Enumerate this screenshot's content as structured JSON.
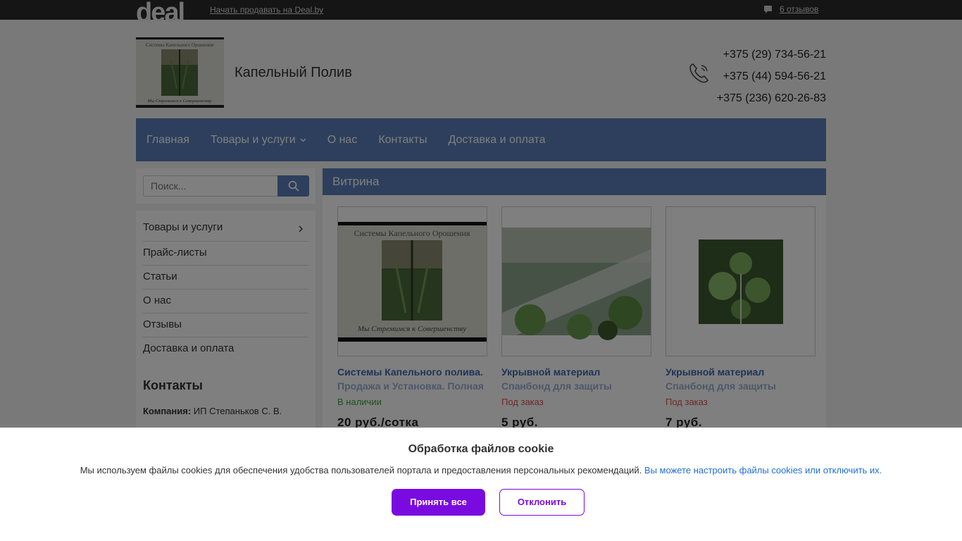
{
  "topbar": {
    "logo": "deal",
    "sell_link": "Начать продавать на Deal.by",
    "reviews": "6 отзывов",
    "reviews_icon": "comment-icon"
  },
  "header": {
    "company_name": "Капельный Полив",
    "logo_caption_top": "Системы Капельного Орошения",
    "logo_caption_bottom": "Мы Стремимся к Совершенству",
    "phones": [
      "+375 (29) 734-56-21",
      "+375 (44) 594-56-21",
      "+375 (236) 620-26-83"
    ],
    "phone_icon": "phone-icon"
  },
  "nav": {
    "items": [
      "Главная",
      "Товары и услуги",
      "О нас",
      "Контакты",
      "Доставка и оплата"
    ],
    "accent": "#5b7eb9"
  },
  "search": {
    "placeholder": "Поиск...",
    "icon": "search-icon"
  },
  "sidebar": {
    "items": [
      "Товары и услуги",
      "Прайс-листы",
      "Статьи",
      "О нас",
      "Отзывы",
      "Доставка и оплата"
    ],
    "contacts_title": "Контакты",
    "company_label": "Компания:",
    "company_value": "ИП Степаньков С. В."
  },
  "main": {
    "title": "Витрина",
    "products": [
      {
        "title": "Системы Капельного полива.",
        "subtitle": "Продажа и Установка. Полная",
        "status": "В наличии",
        "price": "20 руб./сотка",
        "img_caption_top": "Системы Капельного Орошения",
        "img_caption_bottom": "Мы Стремимся к Совершенству"
      },
      {
        "title": "Укрывной материал",
        "subtitle": "Спанбонд для защиты",
        "status": "Под заказ",
        "price": "5 руб."
      },
      {
        "title": "Укрывной материал",
        "subtitle": "Спанбонд для защиты",
        "status": "Под заказ",
        "price": "7 руб."
      }
    ]
  },
  "cookie": {
    "title": "Обработка файлов cookie",
    "text": "Мы используем файлы cookies для обеспечения удобства пользователей портала и предоставления персональных рекомендаций.",
    "link": "Вы можете настроить файлы cookies или отключить их.",
    "accept": "Принять все",
    "decline": "Отклонить",
    "accent": "#7a0be0"
  }
}
